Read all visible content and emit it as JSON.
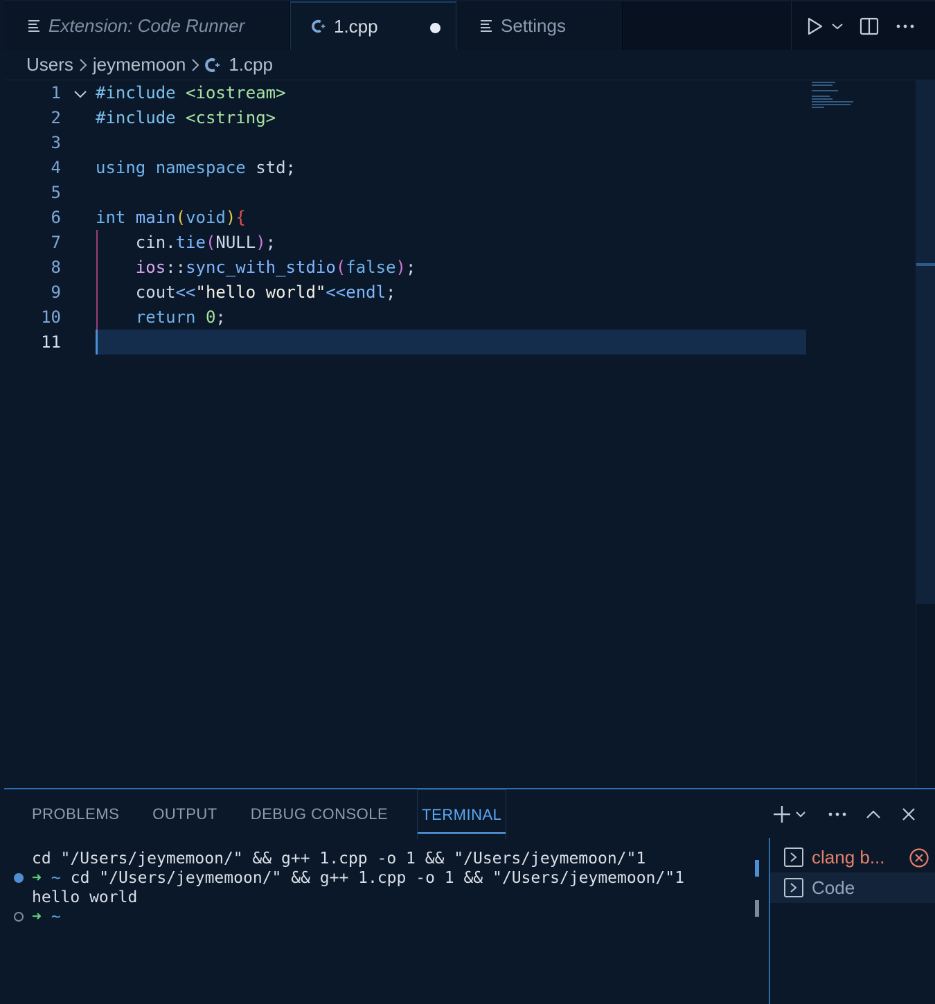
{
  "tabs": [
    {
      "label": "Extension: Code Runner",
      "icon": "preview-lines-icon",
      "italic": true
    },
    {
      "label": "1.cpp",
      "icon": "cpp-file-icon",
      "active": true,
      "dirty": true
    },
    {
      "label": "Settings",
      "icon": "preview-lines-icon"
    }
  ],
  "breadcrumb": {
    "parts": [
      "Users",
      "jeymemoon",
      "1.cpp"
    ]
  },
  "editor": {
    "lines": [
      {
        "n": "1"
      },
      {
        "n": "2"
      },
      {
        "n": "3"
      },
      {
        "n": "4"
      },
      {
        "n": "5"
      },
      {
        "n": "6"
      },
      {
        "n": "7"
      },
      {
        "n": "8"
      },
      {
        "n": "9"
      },
      {
        "n": "10"
      },
      {
        "n": "11"
      }
    ],
    "code": {
      "l1a": "#include",
      "l1b": " <iostream>",
      "l2a": "#include",
      "l2b": " <cstring>",
      "l4a": "using",
      "l4b": " namespace",
      "l4c": " std;",
      "l6a": "int",
      "l6b": " main",
      "l6c": "(",
      "l6d": "void",
      "l6e": ")",
      "l6f": "{",
      "l7a": "    cin.",
      "l7b": "tie",
      "l7c": "(",
      "l7d": "NULL",
      "l7e": ")",
      "l7f": ";",
      "l8a": "    ios",
      "l8b": "::",
      "l8c": "sync_with_stdio",
      "l8d": "(",
      "l8e": "false",
      "l8f": ")",
      "l8g": ";",
      "l9a": "    cout",
      "l9b": "<<",
      "l9c": "\"hello world\"",
      "l9d": "<<",
      "l9e": "endl",
      "l9f": ";",
      "l10a": "    return",
      "l10b": " 0",
      "l10c": ";"
    }
  },
  "panel": {
    "tabs": [
      "PROBLEMS",
      "OUTPUT",
      "DEBUG CONSOLE",
      "TERMINAL"
    ],
    "active_tab": "TERMINAL",
    "terminal": {
      "line1": "cd \"/Users/jeymemoon/\" && g++ 1.cpp -o 1 && \"/Users/jeymemoon/\"1",
      "arrow": "➜",
      "tilde": "~",
      "line2": "cd \"/Users/jeymemoon/\" && g++ 1.cpp -o 1 && \"/Users/jeymemoon/\"1",
      "line3": "hello world"
    },
    "terminal_list": [
      {
        "label": "clang b...",
        "status": "error"
      },
      {
        "label": "Code",
        "selected": true
      }
    ]
  },
  "colors": {
    "accent": "#2a6fb4",
    "background": "#0b1829",
    "error": "#e8806a"
  }
}
